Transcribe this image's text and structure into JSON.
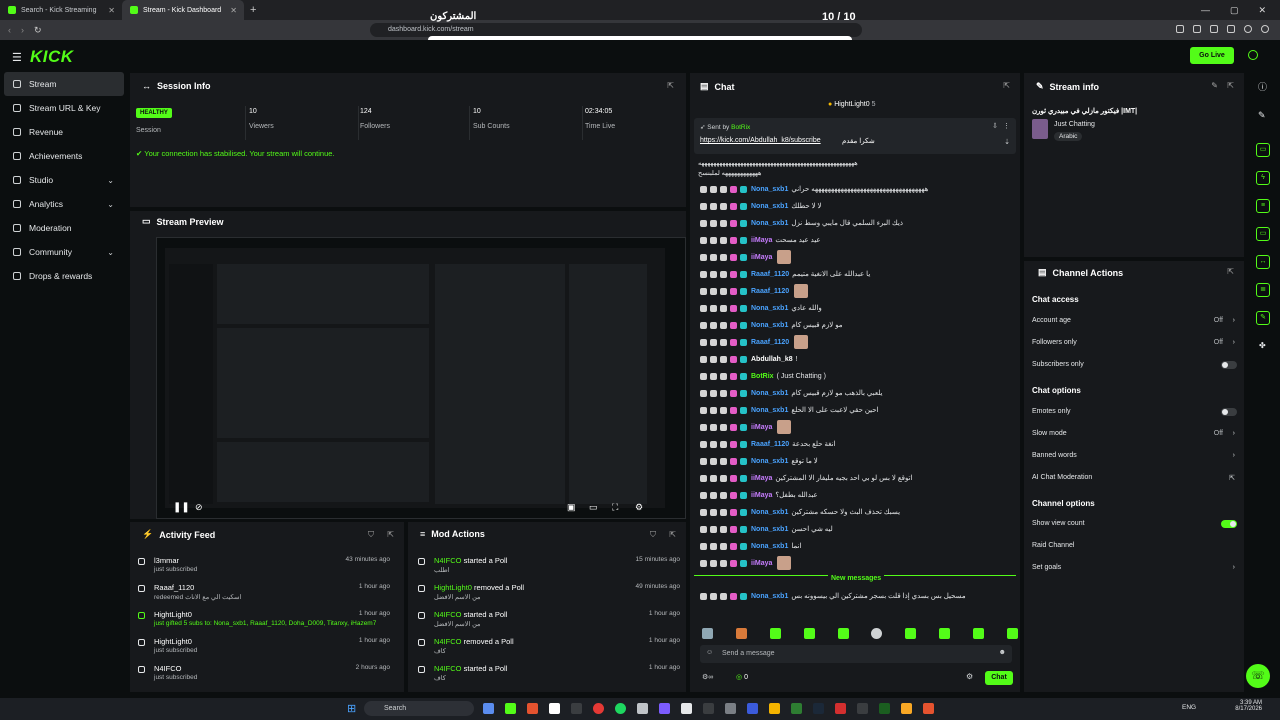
{
  "browser": {
    "tabs": [
      {
        "label": "Search - Kick Streaming"
      },
      {
        "label": "Stream - Kick Dashboard"
      }
    ],
    "url": "dashboard.kick.com/stream"
  },
  "overlay": {
    "title": "المشتركون",
    "count": "10 / 10"
  },
  "header": {
    "logo": "KICK",
    "go_live": "Go Live"
  },
  "nav": [
    {
      "label": "Stream"
    },
    {
      "label": "Stream URL & Key"
    },
    {
      "label": "Revenue"
    },
    {
      "label": "Achievements"
    },
    {
      "label": "Studio"
    },
    {
      "label": "Analytics"
    },
    {
      "label": "Moderation"
    },
    {
      "label": "Community"
    },
    {
      "label": "Drops & rewards"
    }
  ],
  "session": {
    "title": "Session Info",
    "healthy": "HEALTHY",
    "stats": [
      {
        "value": "",
        "label": "Session"
      },
      {
        "value": "10",
        "label": "Viewers"
      },
      {
        "value": "124",
        "label": "Followers"
      },
      {
        "value": "10",
        "label": "Sub Counts"
      },
      {
        "value": "02:34:05",
        "label": "Time Live"
      }
    ],
    "message": "Your connection has stabilised. Your stream will continue."
  },
  "preview": {
    "title": "Stream Preview"
  },
  "activity": {
    "title": "Activity Feed",
    "items": [
      {
        "name": "l3mmar",
        "sub": "just subscribed",
        "time": "43 minutes ago"
      },
      {
        "name": "Raaaf_1120",
        "sub": "redeemed اسكيت الي مع الاناث",
        "time": "1 hour ago"
      },
      {
        "name": "HightLight0",
        "sub": "just gifted 5 subs to: Nona_sxb1, Raaaf_1120, Doha_D009, Titanxy, iHazem7",
        "time": "1 hour ago"
      },
      {
        "name": "HightLight0",
        "sub": "just subscribed",
        "time": "1 hour ago"
      },
      {
        "name": "N4IFCO",
        "sub": "just subscribed",
        "time": "2 hours ago"
      }
    ]
  },
  "mod_actions": {
    "title": "Mod Actions",
    "items": [
      {
        "name": "N4IFCO",
        "action": "started a Poll",
        "sub": "اطلب",
        "time": "15 minutes ago"
      },
      {
        "name": "HightLight0",
        "action": "removed a Poll",
        "sub": "من الاسم الافضل",
        "time": "49 minutes ago"
      },
      {
        "name": "N4IFCO",
        "action": "started a Poll",
        "sub": "من الاسم الافضل",
        "time": "1 hour ago"
      },
      {
        "name": "N4IFCO",
        "action": "removed a Poll",
        "sub": "كاف",
        "time": "1 hour ago"
      },
      {
        "name": "N4IFCO",
        "action": "started a Poll",
        "sub": "كاف",
        "time": "1 hour ago"
      }
    ]
  },
  "chat": {
    "title": "Chat",
    "top_gifter": "HightLight0",
    "top_gifter_count": "5",
    "pinned_by": "Sent by",
    "pinned_user": "BotRix",
    "pinned_link": "https://kick.com/Abdullah_k8/subscribe",
    "pinned_text": "شكرا مقدم",
    "banner_line1": "ههههههههههههههههههههههههههههههههههههههههههههههههههههه",
    "banner_line2": "ههههههههههههه لملبنسح",
    "messages": [
      {
        "user": "Nona_sxb1",
        "color": "#4aa3ff",
        "text": "هههههههههههههههههههههههههههههههههههه حراني"
      },
      {
        "user": "Nona_sxb1",
        "color": "#4aa3ff",
        "text": "لا لا حطلك"
      },
      {
        "user": "Nona_sxb1",
        "color": "#4aa3ff",
        "text": "ذيك البرء السلمي قال مايبي وسط نزل"
      },
      {
        "user": "iiMaya",
        "color": "#c77dff",
        "text": "عيد عيد مسحت"
      },
      {
        "user": "iiMaya",
        "color": "#c77dff",
        "text": ""
      },
      {
        "user": "Raaaf_1120",
        "color": "#4aa3ff",
        "text": "يا عبدالله على الانغية متيمم"
      },
      {
        "user": "Raaaf_1120",
        "color": "#4aa3ff",
        "text": ""
      },
      {
        "user": "Nona_sxb1",
        "color": "#4aa3ff",
        "text": "والله عادي"
      },
      {
        "user": "Nona_sxb1",
        "color": "#4aa3ff",
        "text": "مو لازم قبيس كام"
      },
      {
        "user": "Raaaf_1120",
        "color": "#4aa3ff",
        "text": ""
      },
      {
        "user": "Abdullah_k8",
        "color": "#ffffff",
        "text": "!"
      },
      {
        "user": "BotRix",
        "color": "#53fc18",
        "text": "( Just Chatting )"
      },
      {
        "user": "Nona_sxb1",
        "color": "#4aa3ff",
        "text": "يلعبي بالذهب مو لازم قبيس كام"
      },
      {
        "user": "Nona_sxb1",
        "color": "#4aa3ff",
        "text": "احين حقي لاعبت على الا الحلع"
      },
      {
        "user": "iiMaya",
        "color": "#c77dff",
        "text": ""
      },
      {
        "user": "Raaaf_1120",
        "color": "#4aa3ff",
        "text": "انغة حلع بحدعة"
      },
      {
        "user": "Nona_sxb1",
        "color": "#4aa3ff",
        "text": "لا ما توقع"
      },
      {
        "user": "iiMaya",
        "color": "#c77dff",
        "text": "اتوقع لا بس لو بي احد بجيه مليفار الا المشتركين"
      },
      {
        "user": "iiMaya",
        "color": "#c77dff",
        "text": "عبدالله بطفل؟"
      },
      {
        "user": "Nona_sxb1",
        "color": "#4aa3ff",
        "text": "يسبك تحذف البث ولا حسكه مشتركين"
      },
      {
        "user": "Nona_sxb1",
        "color": "#4aa3ff",
        "text": "ليه شي احسن"
      },
      {
        "user": "Nona_sxb1",
        "color": "#4aa3ff",
        "text": "انما"
      },
      {
        "user": "iiMaya",
        "color": "#c77dff",
        "text": ""
      }
    ],
    "new_messages": "New messages",
    "last_message": {
      "user": "Nona_sxb1",
      "color": "#4aa3ff",
      "text": "مسحيل بس بسدي إذا قلت بسجر مشتركين الي بيسوونه بس"
    },
    "placeholder": "Send a message",
    "count": "0",
    "send": "Chat"
  },
  "stream_info": {
    "title": "Stream info",
    "stream_title": "فيكتور مازلي في مبيدري ثورن |IMT|",
    "category": "Just Chatting",
    "tag": "Arabic"
  },
  "channel_actions": {
    "title": "Channel Actions",
    "chat_access": "Chat access",
    "account_age": "Account age",
    "account_age_val": "Off",
    "followers_only": "Followers only",
    "followers_only_val": "Off",
    "subscribers_only": "Subscribers only",
    "chat_options": "Chat options",
    "emotes_only": "Emotes only",
    "slow_mode": "Slow mode",
    "slow_mode_val": "Off",
    "banned_words": "Banned words",
    "ai_moderation": "AI Chat Moderation",
    "channel_options": "Channel options",
    "show_view_count": "Show view count",
    "raid_channel": "Raid Channel",
    "set_goals": "Set goals"
  },
  "taskbar": {
    "search": "Search",
    "lang": "ENG",
    "time": "3:39 AM",
    "date": "8/17/2026"
  },
  "colors": {
    "accent": "#53fc18",
    "panel": "#17191c",
    "bg": "#0b0e0f"
  }
}
